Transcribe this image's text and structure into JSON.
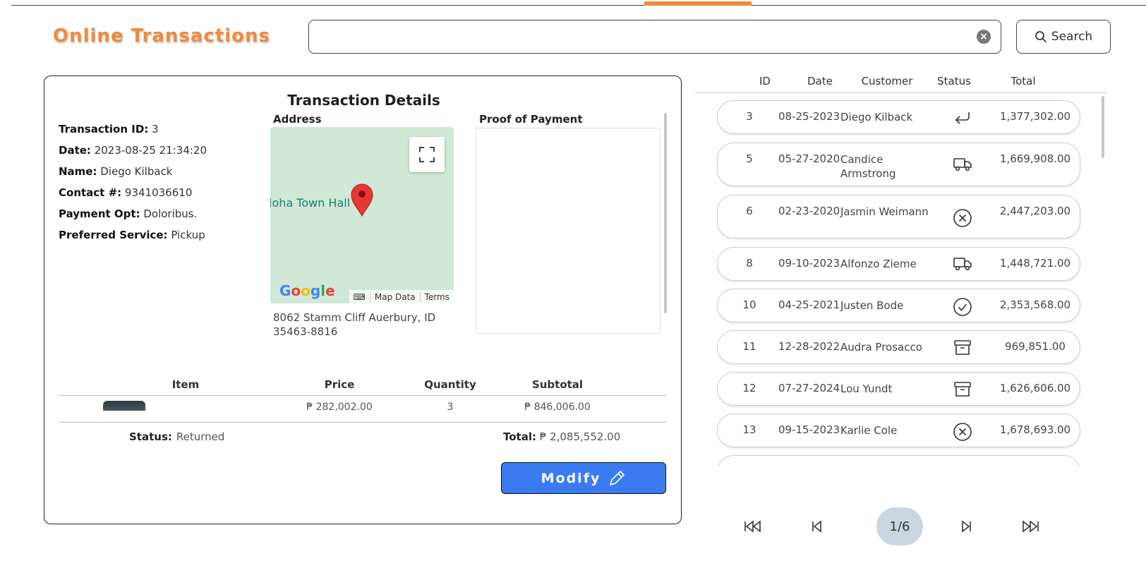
{
  "app": {
    "title": "Online Transactions"
  },
  "search": {
    "placeholder": "",
    "value": "",
    "button_label": "Search"
  },
  "details": {
    "title": "Transaction Details",
    "fields": [
      {
        "label": "Transaction ID:",
        "value": "3"
      },
      {
        "label": "Date:",
        "value": "2023-08-25 21:34:20"
      },
      {
        "label": "Name:",
        "value": "Diego Kilback"
      },
      {
        "label": "Contact #:",
        "value": "9341036610"
      },
      {
        "label": "Payment Opt:",
        "value": "Doloribus."
      },
      {
        "label": "Preferred Service:",
        "value": "Pickup"
      }
    ],
    "address_label": "Address",
    "map": {
      "place_label": "loha Town Hall",
      "google": "Google",
      "map_data": "Map Data",
      "terms": "Terms"
    },
    "address_text": "8062 Stamm Cliff Auerbury, ID 35463-8816",
    "proof_label": "Proof of Payment",
    "items_columns": [
      "Item",
      "Price",
      "Quantity",
      "Subtotal"
    ],
    "items_row_partial": {
      "price": "₱ 282,002.00",
      "quantity": "3",
      "subtotal": "₱ 846,006.00"
    },
    "status_label": "Status:",
    "status_value": "Returned",
    "total_label": "Total:",
    "total_value": "₱ 2,085,552.00",
    "modify_label": "Modify"
  },
  "list": {
    "columns": [
      "ID",
      "Date",
      "Customer",
      "Status",
      "Total"
    ],
    "rows": [
      {
        "id": "3",
        "date": "08-25-2023",
        "customer": "Diego Kilback",
        "status": "returned-icon",
        "total": "1,377,302.00"
      },
      {
        "id": "5",
        "date": "05-27-2020",
        "customer": "Candice Armstrong",
        "status": "delivery-truck-icon",
        "total": "1,669,908.00"
      },
      {
        "id": "6",
        "date": "02-23-2020",
        "customer": "Jasmin Weimann",
        "status": "cancelled-x-icon",
        "total": "2,447,203.00"
      },
      {
        "id": "8",
        "date": "09-10-2023",
        "customer": "Alfonzo Zieme",
        "status": "delivery-truck-icon",
        "total": "1,448,721.00"
      },
      {
        "id": "10",
        "date": "04-25-2021",
        "customer": "Justen Bode",
        "status": "completed-check-icon",
        "total": "2,353,568.00"
      },
      {
        "id": "11",
        "date": "12-28-2022",
        "customer": "Audra Prosacco",
        "status": "archive-box-icon",
        "total": "969,851.00"
      },
      {
        "id": "12",
        "date": "07-27-2024",
        "customer": "Lou Yundt",
        "status": "archive-box-icon",
        "total": "1,626,606.00"
      },
      {
        "id": "13",
        "date": "09-15-2023",
        "customer": "Karlie Cole",
        "status": "cancelled-x-icon",
        "total": "1,678,693.00"
      }
    ]
  },
  "pager": {
    "current": "1/6"
  },
  "colors": {
    "accent": "#f28a3a",
    "primary": "#3a7bf2",
    "pager_current_bg": "#cbd6e3",
    "map_bg": "#cfe9d6"
  }
}
